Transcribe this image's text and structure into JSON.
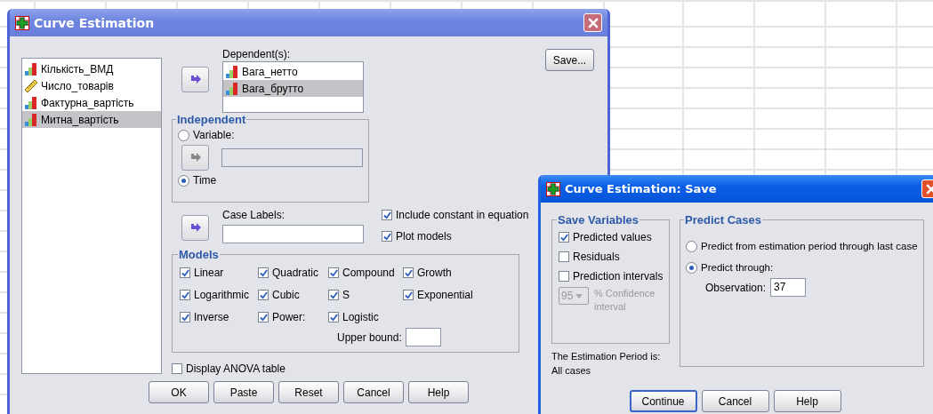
{
  "main_dialog": {
    "title": "Curve Estimation",
    "variables": [
      {
        "name": "Кількість_ВМД",
        "kind": "ordinal",
        "selected": false
      },
      {
        "name": "Число_товарів",
        "kind": "scale",
        "selected": false
      },
      {
        "name": "Фактурна_вартість",
        "kind": "ordinal",
        "selected": false
      },
      {
        "name": "Митна_вартість",
        "kind": "ordinal",
        "selected": true
      }
    ],
    "dependents_label": "Dependent(s):",
    "dependents": [
      {
        "name": "Вага_нетто",
        "kind": "ordinal",
        "selected": false
      },
      {
        "name": "Вага_брутто",
        "kind": "ordinal",
        "selected": true
      }
    ],
    "save_button": "Save...",
    "independent": {
      "title": "Independent",
      "variable_disabled": true,
      "options": [
        {
          "label": "Variable:",
          "selected": false
        },
        {
          "label": "Time",
          "selected": true
        }
      ]
    },
    "case_labels_label": "Case Labels:",
    "options": [
      {
        "label": "Include constant in equation",
        "checked": true
      },
      {
        "label": "Plot models",
        "checked": true
      }
    ],
    "models": {
      "title": "Models",
      "items": [
        {
          "label": "Linear",
          "checked": true
        },
        {
          "label": "Quadratic",
          "checked": true
        },
        {
          "label": "Compound",
          "checked": true
        },
        {
          "label": "Growth",
          "checked": true
        },
        {
          "label": "Logarithmic",
          "checked": true
        },
        {
          "label": "Cubic",
          "checked": true
        },
        {
          "label": "S",
          "checked": true
        },
        {
          "label": "Exponential",
          "checked": true
        },
        {
          "label": "Inverse",
          "checked": true
        },
        {
          "label": "Power:",
          "checked": true
        },
        {
          "label": "Logistic",
          "checked": true
        }
      ],
      "upper_bound_label": "Upper bound:"
    },
    "anova": {
      "label": "Display ANOVA table",
      "checked": false
    },
    "buttons": [
      "OK",
      "Paste",
      "Reset",
      "Cancel",
      "Help"
    ]
  },
  "save_dialog": {
    "title": "Curve Estimation: Save",
    "save_variables": {
      "title": "Save Variables",
      "items": [
        {
          "label": "Predicted values",
          "checked": true
        },
        {
          "label": "Residuals",
          "checked": false
        },
        {
          "label": "Prediction intervals",
          "checked": false
        }
      ],
      "confidence": {
        "value": "95",
        "label": "% Confidence interval",
        "disabled": true
      }
    },
    "estimation_period": [
      "The Estimation Period is:",
      "All cases"
    ],
    "predict_cases": {
      "title": "Predict Cases",
      "options": [
        {
          "label": "Predict from estimation period through last case",
          "selected": false
        },
        {
          "label": "Predict through:",
          "selected": true
        }
      ],
      "observation_label": "Observation:",
      "observation_value": "37"
    },
    "buttons": [
      {
        "label": "Continue",
        "selected": true
      },
      {
        "label": "Cancel",
        "selected": false
      },
      {
        "label": "Help",
        "selected": false
      }
    ]
  }
}
